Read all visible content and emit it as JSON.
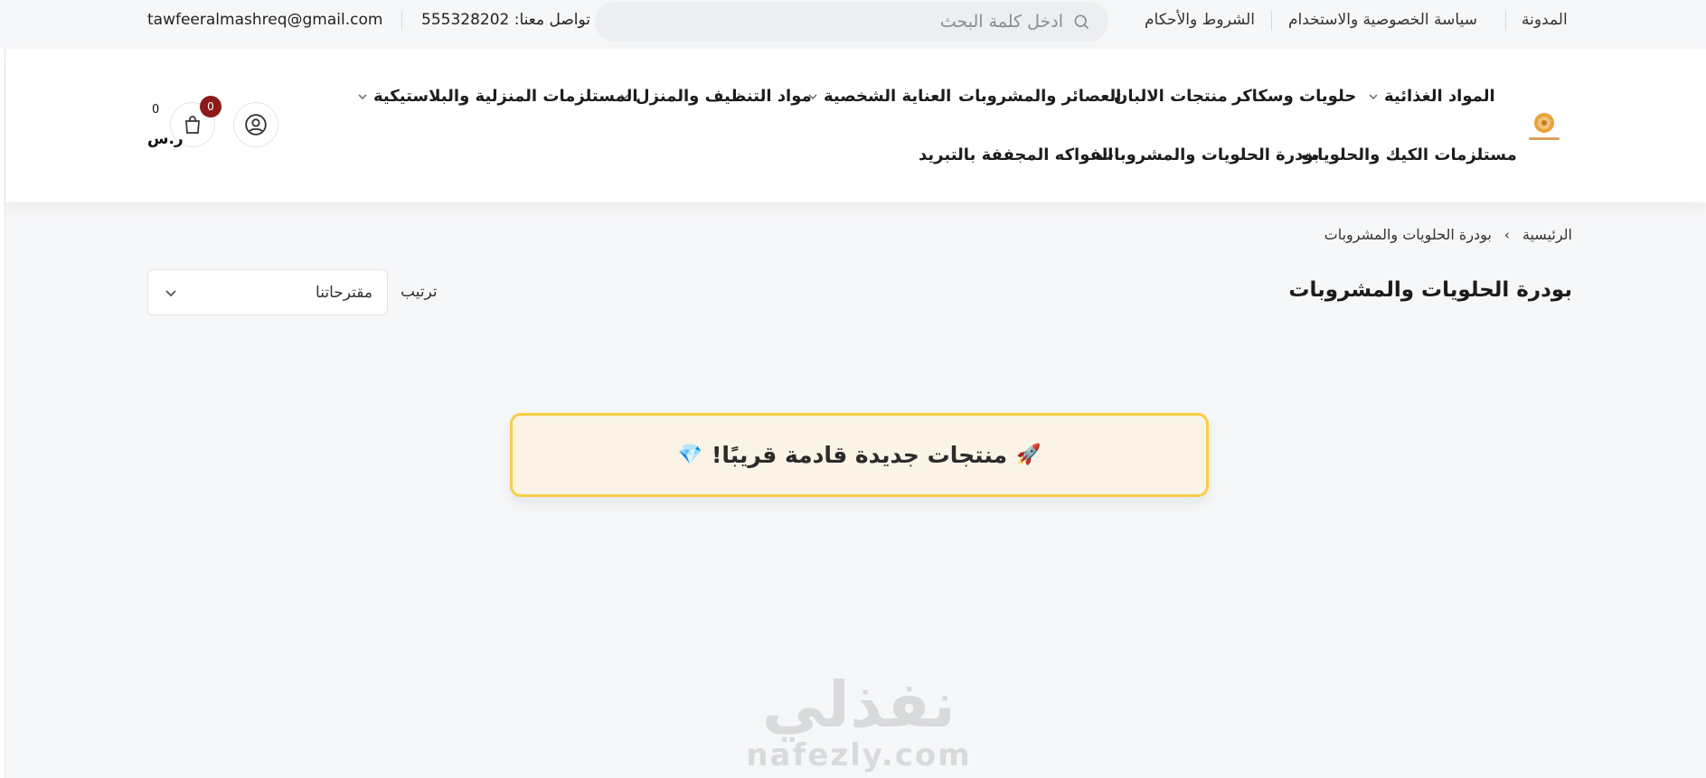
{
  "topbar": {
    "email": "tawfeeralmashreq@gmail.com",
    "contact": "تواصل معنا: 555328202",
    "search_placeholder": "ادخل كلمة البحث",
    "links": [
      "المدونة",
      "سياسة الخصوصية والاستخدام",
      "الشروط والأحكام"
    ]
  },
  "nav": {
    "row1": [
      "المواد الغذائية",
      "حلويات وسكاكر",
      "منتجات الالبان",
      "العصائر والمشروبات",
      "العناية الشخصية",
      "مواد التنظيف والمنزل",
      "المستلزمات المنزلية والبلاستيكية"
    ],
    "row2": [
      "مستلزمات الكيك والحلويات",
      "بودرة الحلويات والمشروبات",
      "الفواكه المجففة بالتبريد"
    ]
  },
  "cart": {
    "count": "0",
    "total": "0",
    "currency": "ر.س"
  },
  "breadcrumb": {
    "home": "الرئيسية",
    "current": "بودرة الحلويات والمشروبات"
  },
  "page": {
    "title": "بودرة الحلويات والمشروبات",
    "sort_label": "ترتيب",
    "sort_value": "مقترحاتنا"
  },
  "notice": {
    "text": "منتجات جديدة قادمة قريبًا!",
    "icon_left": "💎",
    "icon_right": "🚀"
  },
  "watermark": {
    "arabic": "نفذلي",
    "latin": "nafezly.com"
  },
  "colors": {
    "badge": "#8b1a1a",
    "notice_border": "#f6cf43",
    "notice_bg": "#faf3e6"
  }
}
